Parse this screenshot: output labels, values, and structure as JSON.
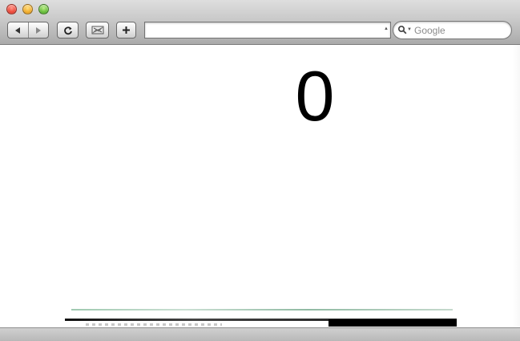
{
  "browser": {
    "toolbar": {
      "back_icon": "back-arrow-icon",
      "forward_icon": "forward-arrow-icon",
      "reload_icon": "reload-icon",
      "screenshot_icon": "screenshot-icon",
      "add_bookmark_icon": "plus-icon"
    },
    "address_bar": {
      "value": "",
      "placeholder": ""
    },
    "search": {
      "placeholder": "Google",
      "icon": "search-icon"
    }
  },
  "page": {
    "counter_value": "0"
  },
  "colors": {
    "window_chrome": "#c9c9c9",
    "page_background": "#ffffff",
    "counter_text": "#000000"
  }
}
